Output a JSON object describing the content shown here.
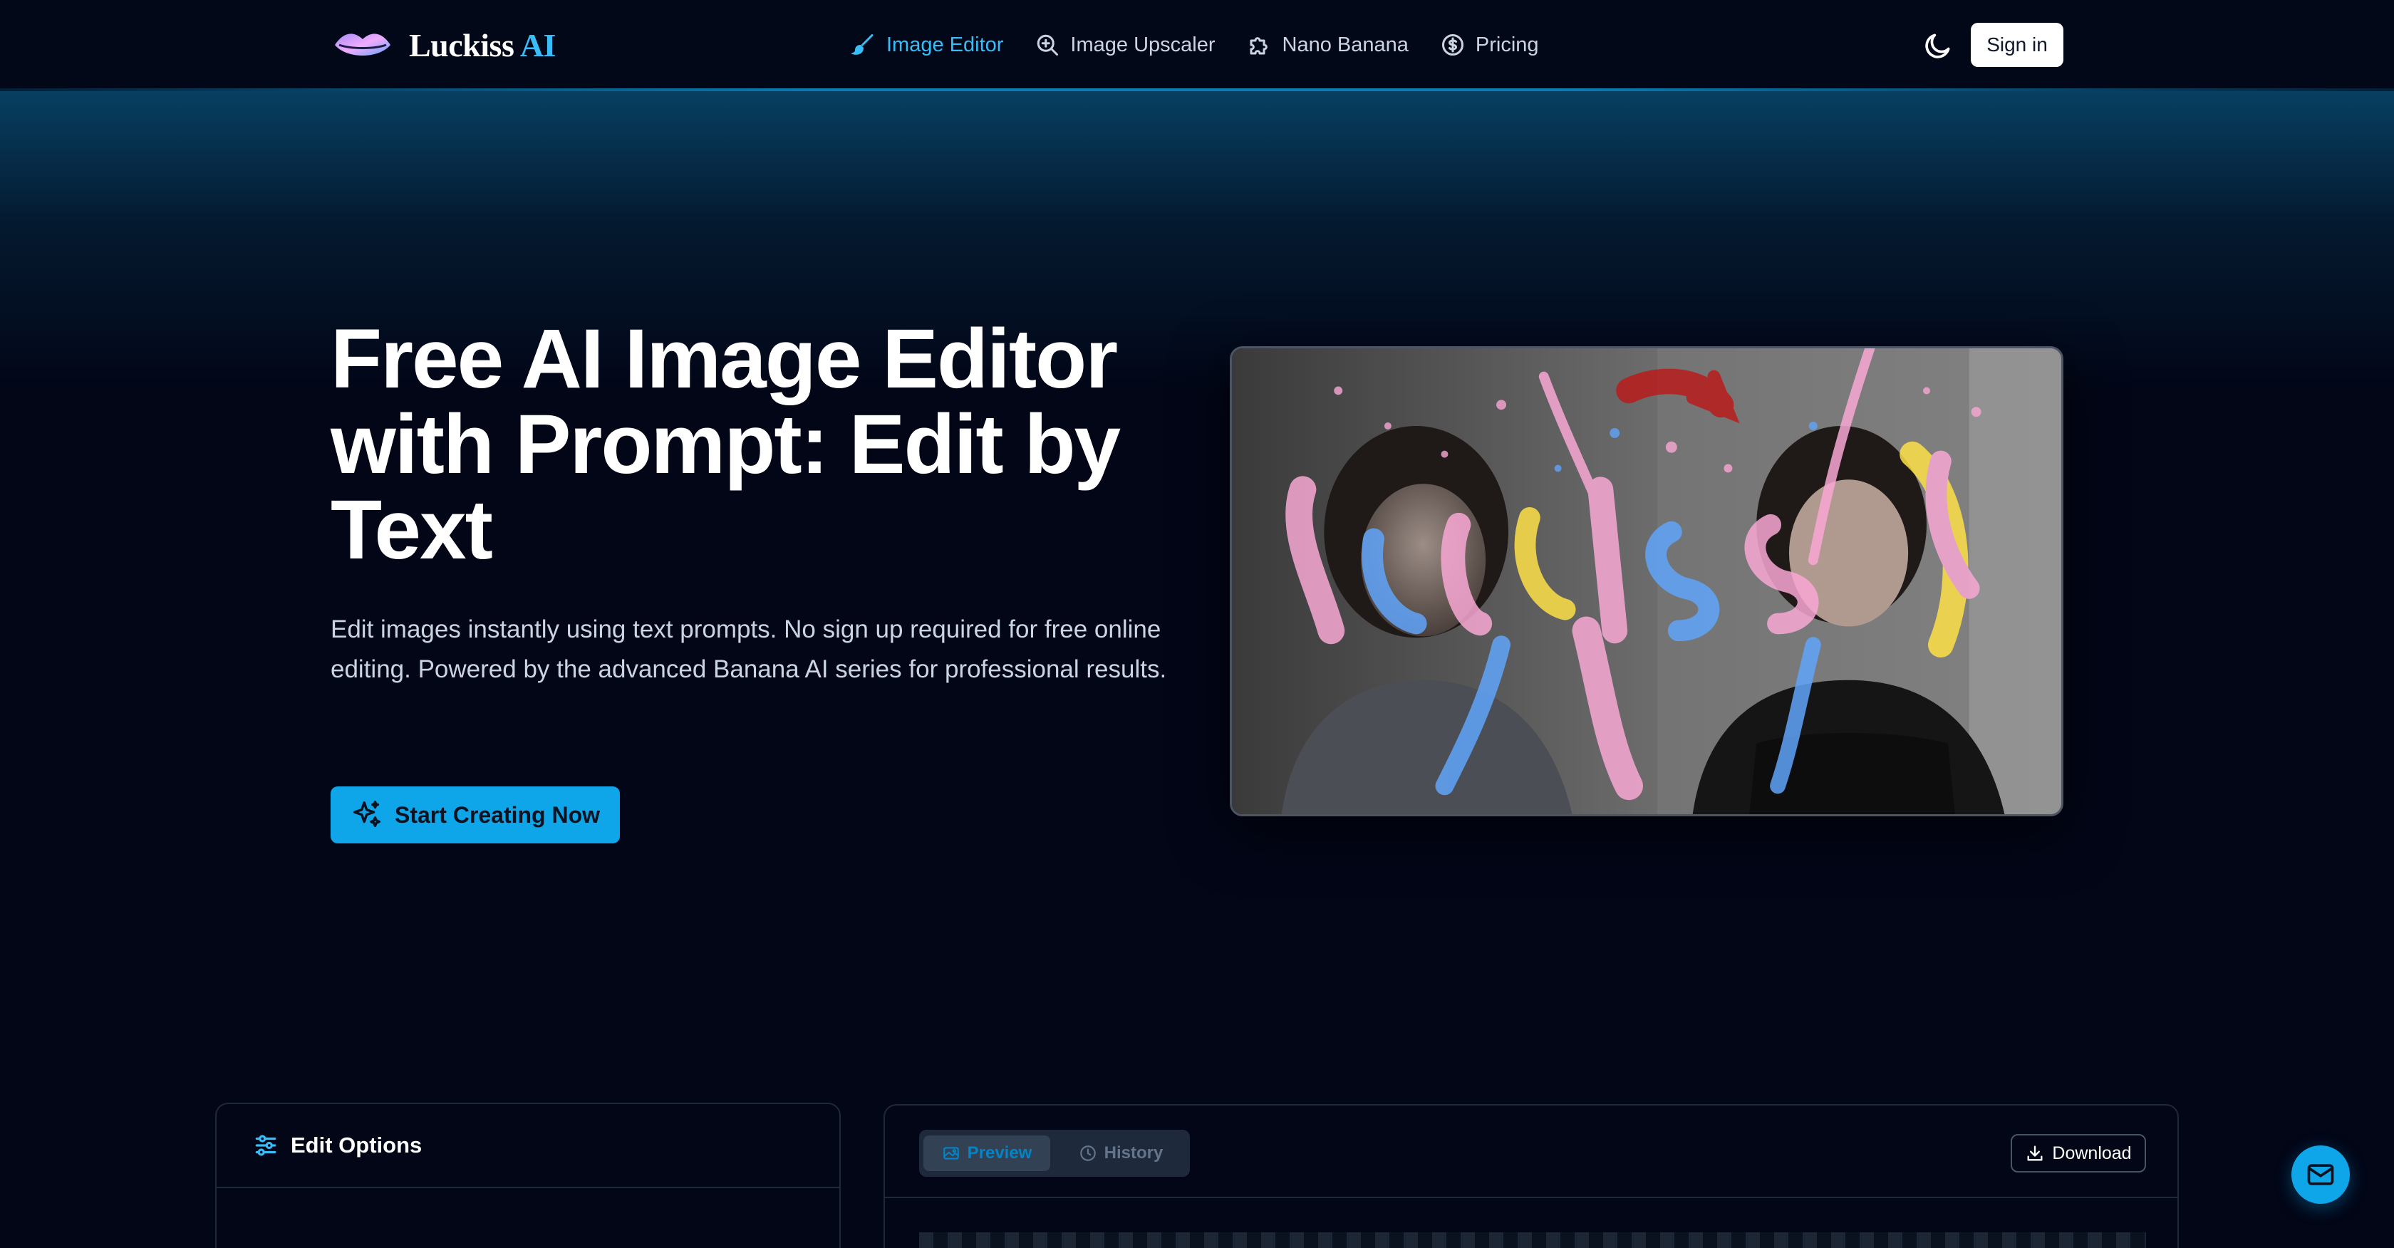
{
  "brand": {
    "name": "Luckiss",
    "accent": "AI",
    "accent_color": "#38bdf8"
  },
  "nav": {
    "items": [
      {
        "label": "Image Editor",
        "icon": "brush-icon",
        "active": true
      },
      {
        "label": "Image Upscaler",
        "icon": "zoom-in-icon",
        "active": false
      },
      {
        "label": "Nano Banana",
        "icon": "puzzle-icon",
        "active": false
      },
      {
        "label": "Pricing",
        "icon": "dollar-icon",
        "active": false
      }
    ],
    "theme_icon": "moon-icon",
    "signin_label": "Sign in"
  },
  "hero": {
    "title": "Free AI Image Editor with Prompt: Edit by Text",
    "description": "Edit images instantly using text prompts. No sign up required for free online editing. Powered by the advanced Banana AI series for professional results.",
    "cta_label": "Start Creating Now",
    "image_icon": "hero-example-image"
  },
  "edit_options": {
    "title": "Edit Options",
    "icon": "sliders-icon"
  },
  "preview_panel": {
    "tabs": [
      {
        "label": "Preview",
        "icon": "image-icon",
        "active": true
      },
      {
        "label": "History",
        "icon": "clock-icon",
        "active": false
      }
    ],
    "download_label": "Download"
  },
  "fab_icon": "mail-icon",
  "colors": {
    "primary": "#0ea5e9",
    "background": "#020617"
  }
}
